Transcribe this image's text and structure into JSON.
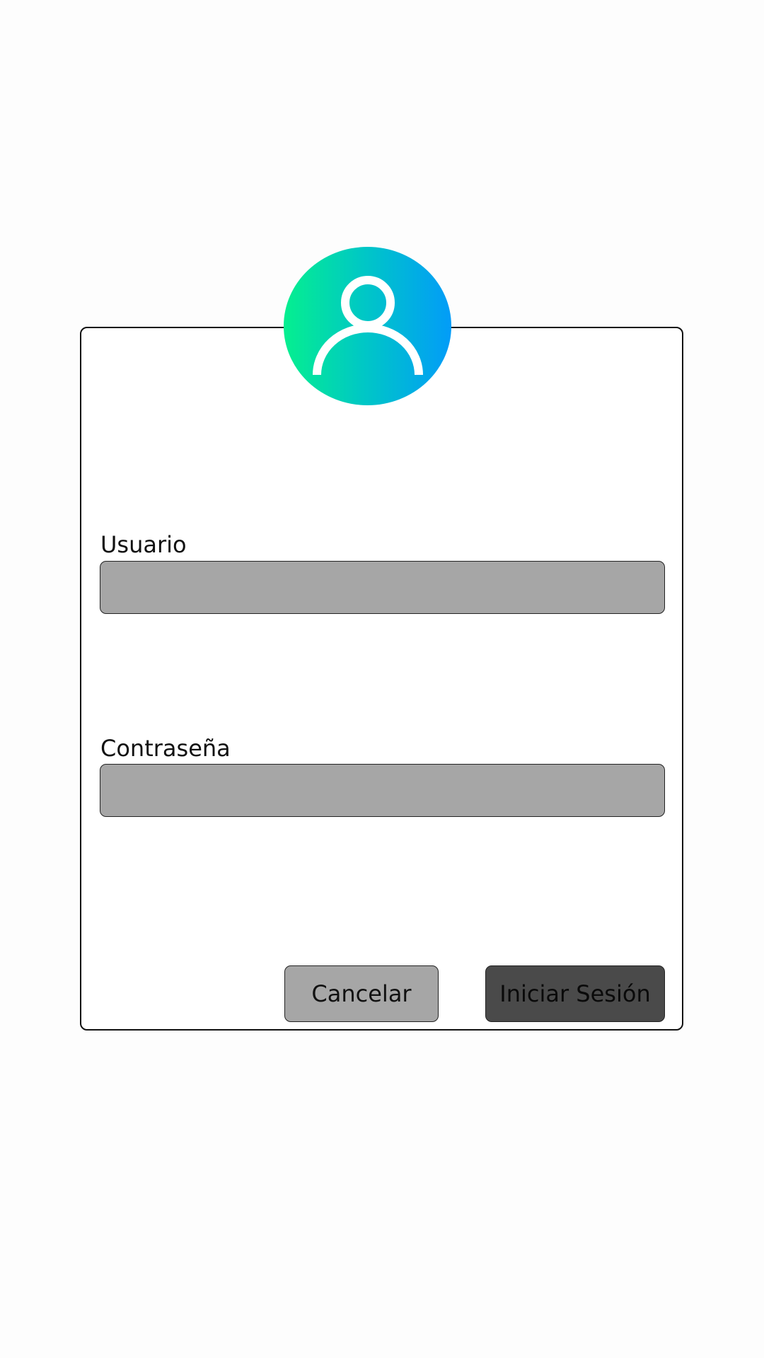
{
  "form": {
    "username_label": "Usuario",
    "username_value": "",
    "password_label": "Contraseña",
    "password_value": ""
  },
  "buttons": {
    "cancel_label": "Cancelar",
    "login_label": "Iniciar Sesión"
  },
  "avatar": {
    "icon": "user-icon",
    "gradient_colors": [
      "#05ef8f",
      "#00c7c6",
      "#029cf8"
    ]
  },
  "colors": {
    "input_background": "#a6a6a6",
    "login_button_background": "#4a4a4a",
    "cancel_button_background": "#a6a6a6"
  }
}
